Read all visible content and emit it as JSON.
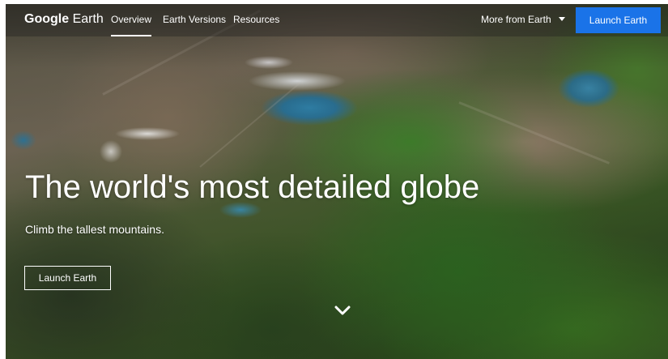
{
  "header": {
    "brand_google": "Google",
    "brand_earth": "Earth",
    "nav_items": [
      {
        "label": "Overview",
        "active": true
      },
      {
        "label": "Earth Versions",
        "active": false
      },
      {
        "label": "Resources",
        "active": false
      }
    ],
    "more_label": "More from Earth",
    "launch_label": "Launch Earth"
  },
  "hero": {
    "headline": "The world's most detailed globe",
    "subline": "Climb the tallest mountains.",
    "launch_label": "Launch Earth",
    "scroll_icon": "chevron-down-icon"
  },
  "colors": {
    "accent": "#1a73e8",
    "text": "#ffffff"
  }
}
